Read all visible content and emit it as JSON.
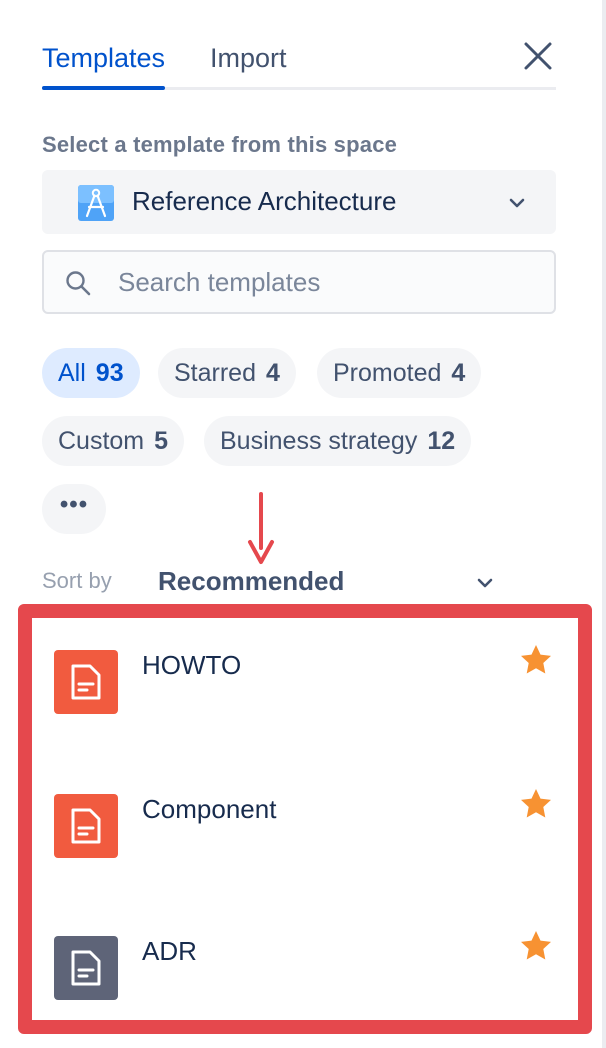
{
  "tabs": [
    {
      "label": "Templates",
      "active": true
    },
    {
      "label": "Import",
      "active": false
    }
  ],
  "space": {
    "label": "Select a template from this space",
    "selected": "Reference Architecture",
    "icon": "compass-icon"
  },
  "search": {
    "placeholder": "Search templates",
    "value": ""
  },
  "filters": [
    {
      "label": "All",
      "count": "93",
      "active": true
    },
    {
      "label": "Starred",
      "count": "4",
      "active": false
    },
    {
      "label": "Promoted",
      "count": "4",
      "active": false
    },
    {
      "label": "Custom",
      "count": "5",
      "active": false
    },
    {
      "label": "Business strategy",
      "count": "12",
      "active": false
    },
    {
      "label": "•••",
      "count": null,
      "active": false
    }
  ],
  "sort": {
    "label": "Sort by",
    "value": "Recommended"
  },
  "templates": [
    {
      "title": "HOWTO",
      "icon": "document-icon",
      "icon_color": "#f15b3f",
      "starred": true
    },
    {
      "title": "Component",
      "icon": "document-icon",
      "icon_color": "#f15b3f",
      "starred": true
    },
    {
      "title": "ADR",
      "icon": "document-icon",
      "icon_color": "#5e6478",
      "starred": true
    }
  ],
  "colors": {
    "accent": "#0052cc",
    "active_chip_bg": "#deebff",
    "star": "#f79232",
    "annotation": "#e5484d"
  }
}
